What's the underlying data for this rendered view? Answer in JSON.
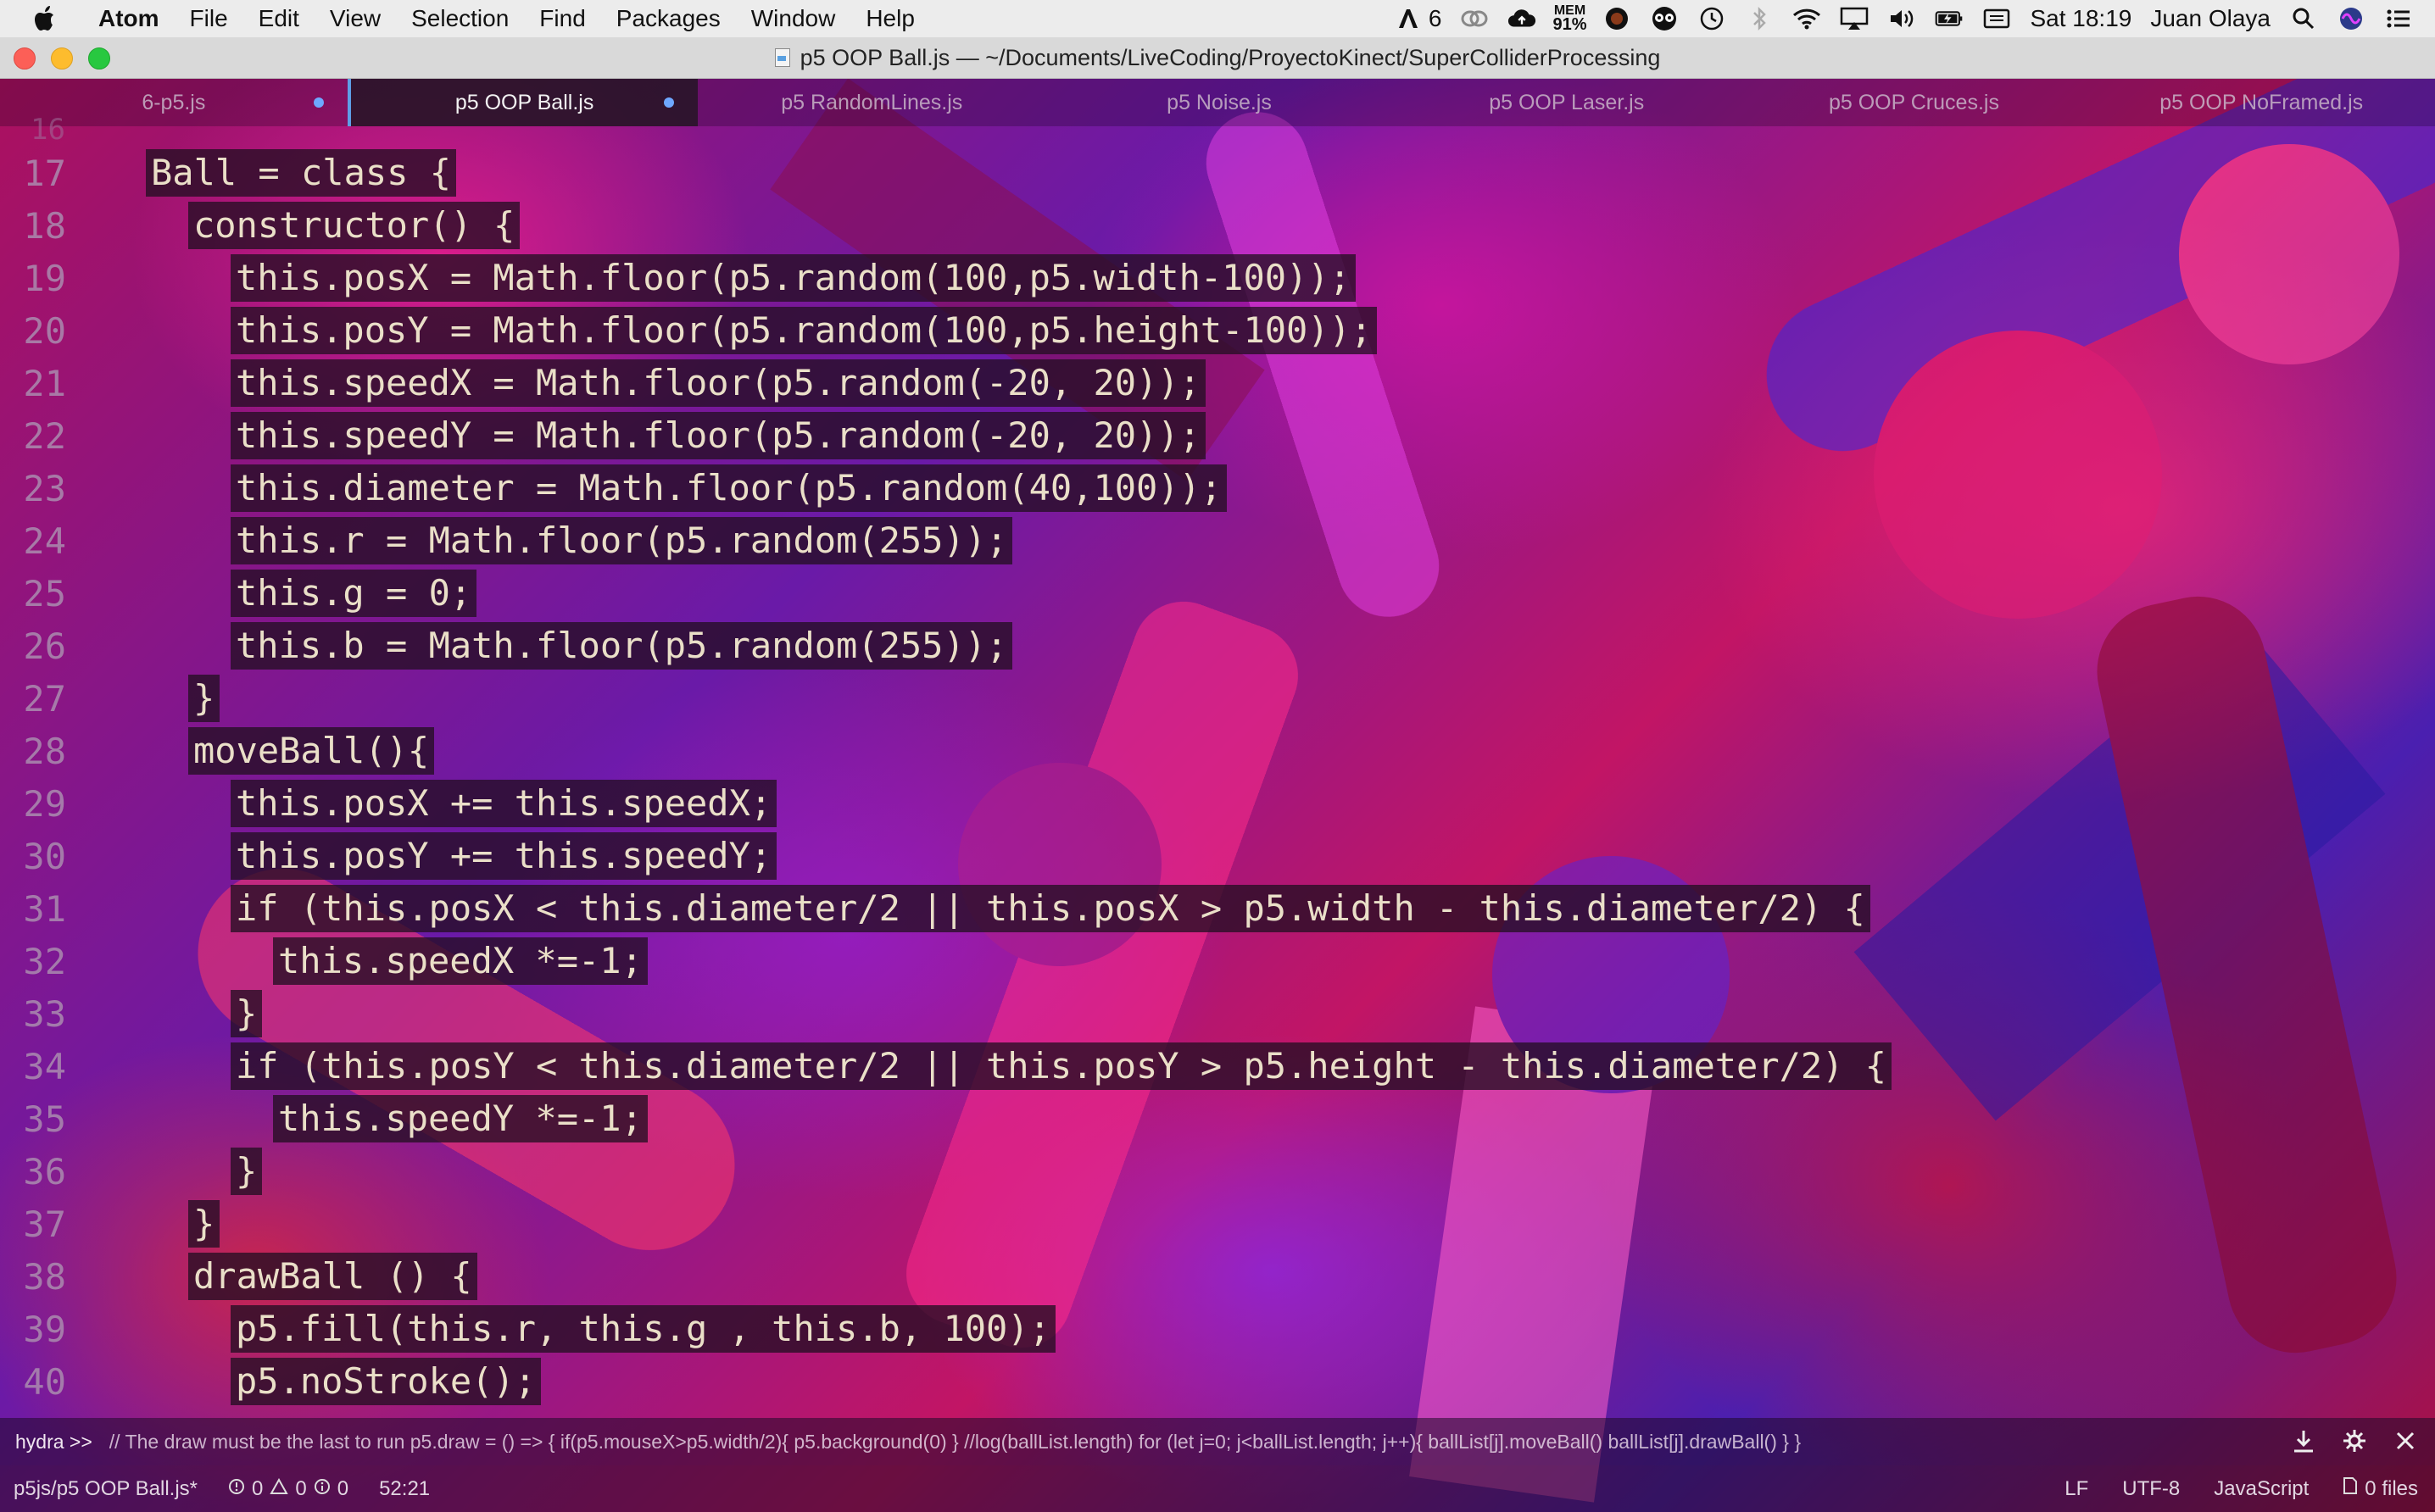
{
  "menubar": {
    "app_name": "Atom",
    "items": [
      "File",
      "Edit",
      "View",
      "Selection",
      "Find",
      "Packages",
      "Window",
      "Help"
    ],
    "status": {
      "adobe_count": "6",
      "mem_label": "MEM",
      "mem_value": "91%",
      "datetime": "Sat 18:19",
      "user": "Juan Olaya"
    }
  },
  "window": {
    "title": "p5 OOP Ball.js — ~/Documents/LiveCoding/ProyectoKinect/SuperColliderProcessing"
  },
  "tabs": [
    {
      "label": "6-p5.js",
      "modified": true,
      "active": false
    },
    {
      "label": "p5 OOP Ball.js",
      "modified": true,
      "active": true
    },
    {
      "label": "p5 RandomLines.js",
      "modified": false,
      "active": false
    },
    {
      "label": "p5 Noise.js",
      "modified": false,
      "active": false
    },
    {
      "label": "p5 OOP Laser.js",
      "modified": false,
      "active": false
    },
    {
      "label": "p5 OOP Cruces.js",
      "modified": false,
      "active": false
    },
    {
      "label": "p5 OOP NoFramed.js",
      "modified": false,
      "active": false
    }
  ],
  "editor": {
    "ghost_line_number": "16",
    "lines": [
      {
        "n": "17",
        "indent": 0,
        "text": "Ball = class {"
      },
      {
        "n": "18",
        "indent": 1,
        "text": "constructor() {"
      },
      {
        "n": "19",
        "indent": 2,
        "text": "this.posX = Math.floor(p5.random(100,p5.width-100));"
      },
      {
        "n": "20",
        "indent": 2,
        "text": "this.posY = Math.floor(p5.random(100,p5.height-100));"
      },
      {
        "n": "21",
        "indent": 2,
        "text": "this.speedX = Math.floor(p5.random(-20, 20));"
      },
      {
        "n": "22",
        "indent": 2,
        "text": "this.speedY = Math.floor(p5.random(-20, 20));"
      },
      {
        "n": "23",
        "indent": 2,
        "text": "this.diameter = Math.floor(p5.random(40,100));"
      },
      {
        "n": "24",
        "indent": 2,
        "text": "this.r = Math.floor(p5.random(255));"
      },
      {
        "n": "25",
        "indent": 2,
        "text": "this.g = 0;"
      },
      {
        "n": "26",
        "indent": 2,
        "text": "this.b = Math.floor(p5.random(255));"
      },
      {
        "n": "27",
        "indent": 1,
        "text": "}"
      },
      {
        "n": "28",
        "indent": 1,
        "text": "moveBall(){"
      },
      {
        "n": "29",
        "indent": 2,
        "text": "this.posX += this.speedX;"
      },
      {
        "n": "30",
        "indent": 2,
        "text": "this.posY += this.speedY;"
      },
      {
        "n": "31",
        "indent": 2,
        "text": "if (this.posX < this.diameter/2 || this.posX > p5.width - this.diameter/2) {"
      },
      {
        "n": "32",
        "indent": 3,
        "text": "this.speedX *=-1;"
      },
      {
        "n": "33",
        "indent": 2,
        "text": "}"
      },
      {
        "n": "34",
        "indent": 2,
        "text": "if (this.posY < this.diameter/2 || this.posY > p5.height - this.diameter/2) {"
      },
      {
        "n": "35",
        "indent": 3,
        "text": "this.speedY *=-1;"
      },
      {
        "n": "36",
        "indent": 2,
        "text": "}"
      },
      {
        "n": "37",
        "indent": 1,
        "text": "}"
      },
      {
        "n": "38",
        "indent": 1,
        "text": "drawBall () {"
      },
      {
        "n": "39",
        "indent": 2,
        "text": "p5.fill(this.r, this.g , this.b, 100);"
      },
      {
        "n": "40",
        "indent": 2,
        "text": "p5.noStroke();"
      }
    ]
  },
  "hydra": {
    "prompt": "hydra >>",
    "text": "// The draw must be the last to run p5.draw = () => { if(p5.mouseX>p5.width/2){ p5.background(0) } //log(ballList.length) for (let j=0; j<ballList.length; j++){ ballList[j].moveBall() ballList[j].drawBall() } }"
  },
  "statusbar": {
    "file_path": "p5js/p5 OOP Ball.js*",
    "errors": "0",
    "warnings": "0",
    "infos": "0",
    "cursor": "52:21",
    "line_ending": "LF",
    "encoding": "UTF-8",
    "grammar": "JavaScript",
    "git_files": "0 files"
  },
  "theme": {
    "accent": "#5e9ee6",
    "code_bg": "rgba(36,14,34,0.78)"
  }
}
